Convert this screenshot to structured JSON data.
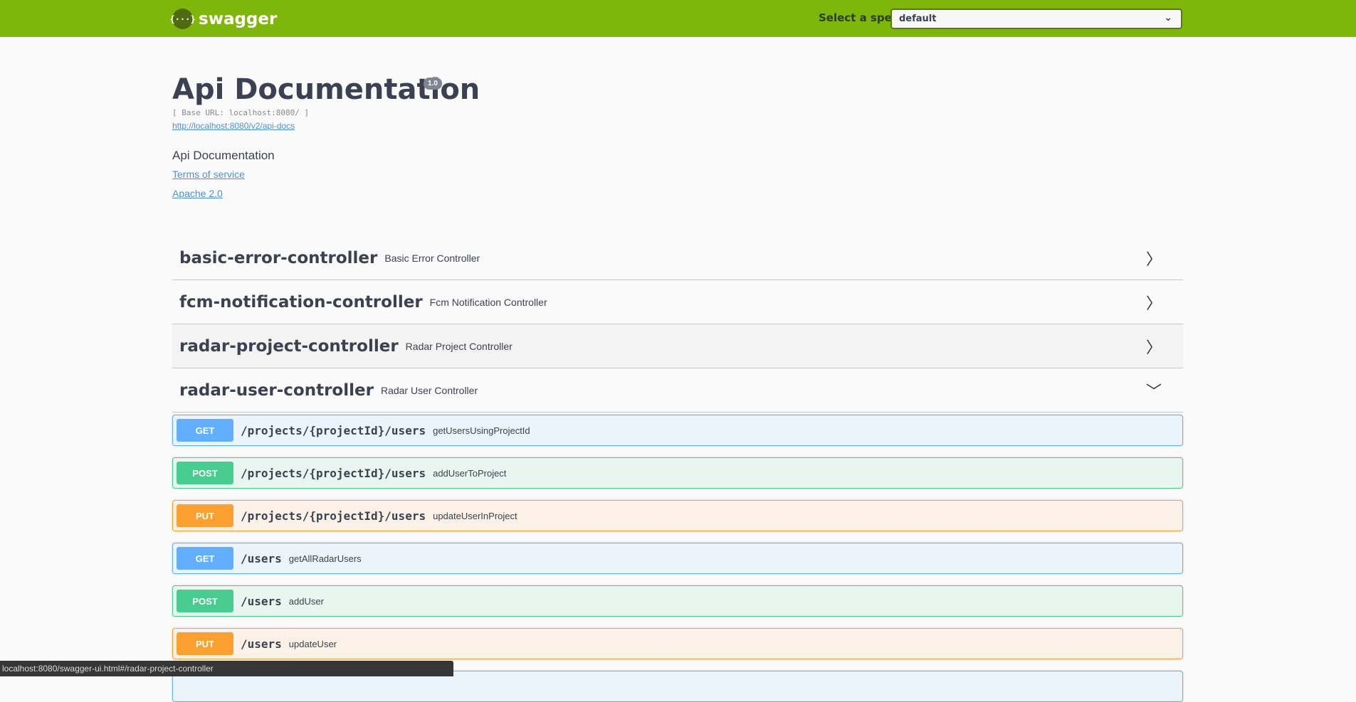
{
  "topbar": {
    "logo_text": "swagger",
    "logo_glyph": "{···}",
    "spec_label": "Select a spec",
    "spec_value": "default",
    "brand_color": "#7eb70a"
  },
  "info": {
    "title": "Api Documentation",
    "version": "1.0",
    "base_url": "[ Base URL: localhost:8080/ ]",
    "api_docs_link": "http://localhost:8080/v2/api-docs",
    "description": "Api Documentation",
    "terms": "Terms of service",
    "license": "Apache 2.0"
  },
  "tags": [
    {
      "name": "basic-error-controller",
      "description": "Basic Error Controller",
      "expanded": false
    },
    {
      "name": "fcm-notification-controller",
      "description": "Fcm Notification Controller",
      "expanded": false
    },
    {
      "name": "radar-project-controller",
      "description": "Radar Project Controller",
      "expanded": false
    },
    {
      "name": "radar-user-controller",
      "description": "Radar User Controller",
      "expanded": true
    }
  ],
  "operations": [
    {
      "method": "GET",
      "path": "/projects/{projectId}/users",
      "summary": "getUsersUsingProjectId"
    },
    {
      "method": "POST",
      "path": "/projects/{projectId}/users",
      "summary": "addUserToProject"
    },
    {
      "method": "PUT",
      "path": "/projects/{projectId}/users",
      "summary": "updateUserInProject"
    },
    {
      "method": "GET",
      "path": "/users",
      "summary": "getAllRadarUsers"
    },
    {
      "method": "POST",
      "path": "/users",
      "summary": "addUser"
    },
    {
      "method": "PUT",
      "path": "/users",
      "summary": "updateUser"
    }
  ],
  "status_bar": "localhost:8080/swagger-ui.html#/radar-project-controller"
}
